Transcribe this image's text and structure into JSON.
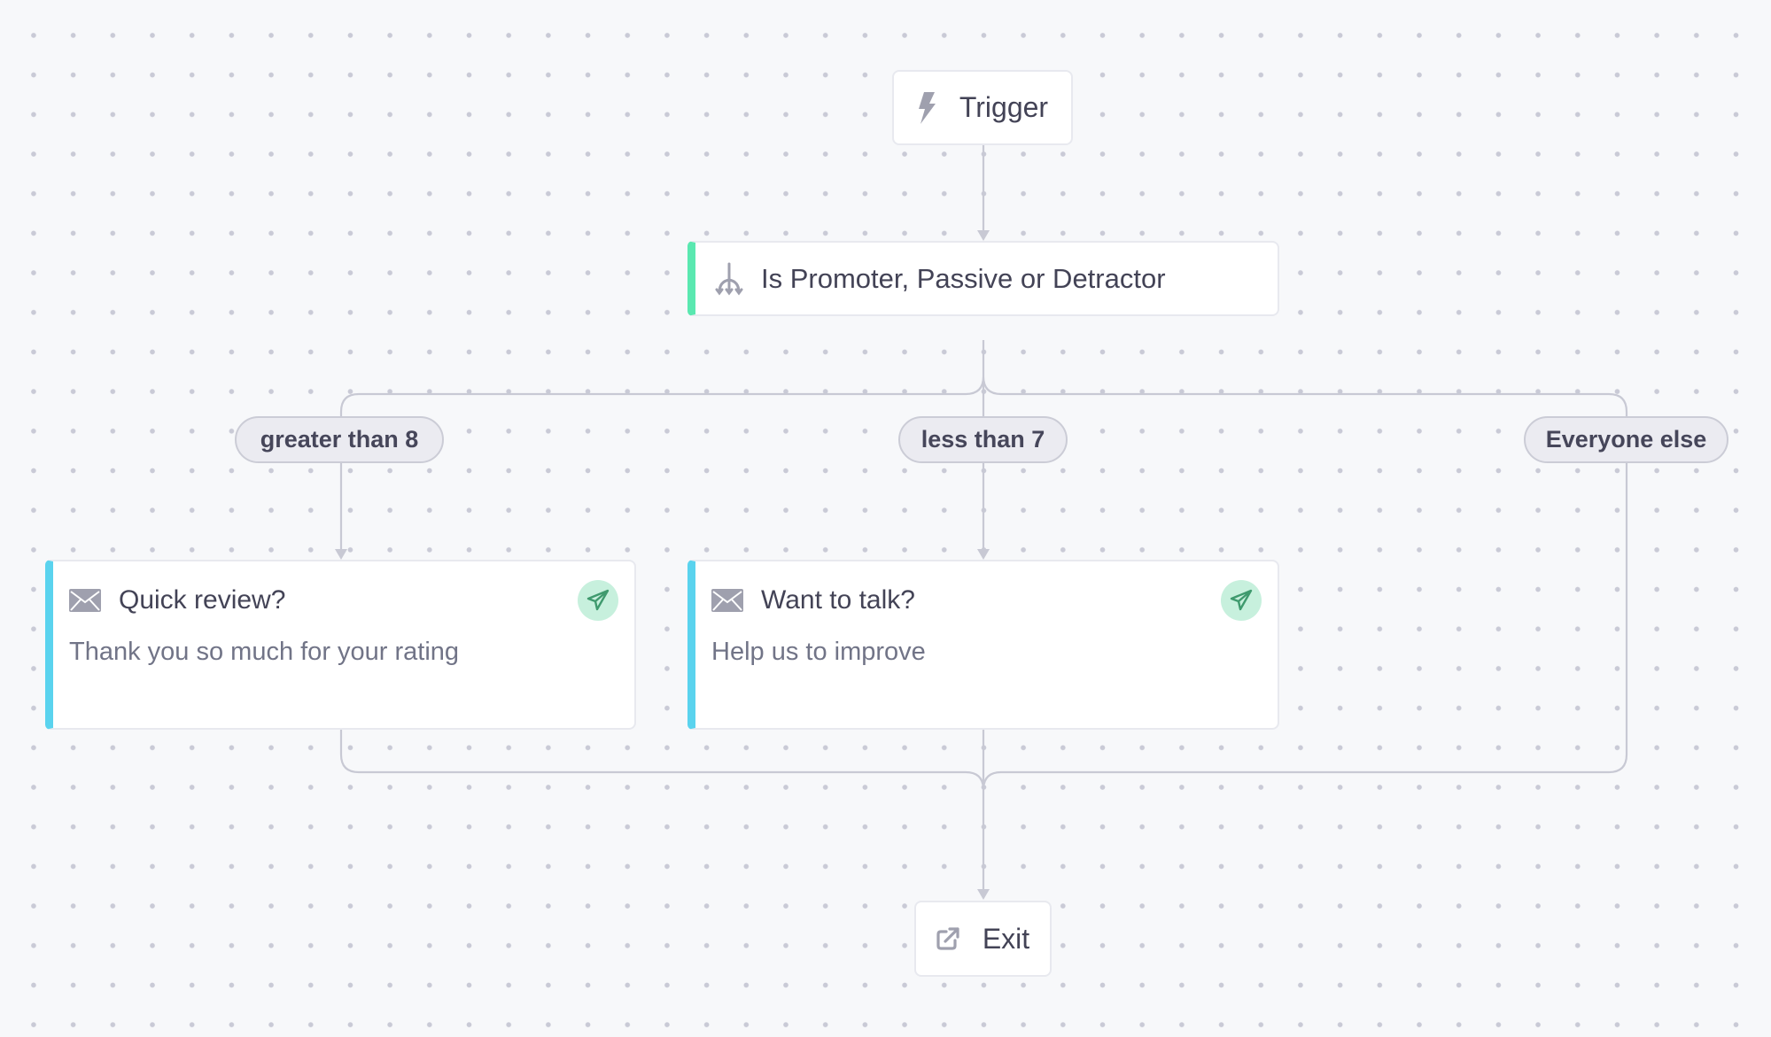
{
  "flow": {
    "trigger": {
      "label": "Trigger",
      "icon": "lightning-icon"
    },
    "branch": {
      "label": "Is Promoter, Passive or Detractor",
      "icon": "split-icon",
      "accent": "#5ae8b0"
    },
    "conditions": [
      {
        "label": "greater than 8"
      },
      {
        "label": "less than 7"
      },
      {
        "label": "Everyone else"
      }
    ],
    "messages": [
      {
        "title": "Quick review?",
        "body": "Thank you so much for your rating",
        "icon": "envelope-icon",
        "status_icon": "send-icon",
        "accent": "#5ad3ee"
      },
      {
        "title": "Want to talk?",
        "body": "Help us to improve",
        "icon": "envelope-icon",
        "status_icon": "send-icon",
        "accent": "#5ad3ee"
      }
    ],
    "exit": {
      "label": "Exit",
      "icon": "external-link-icon"
    }
  },
  "colors": {
    "background": "#f7f8fa",
    "edge": "#c8c9d4",
    "branch_accent": "#5ae8b0",
    "message_accent": "#5ad3ee",
    "send_badge": "#c7f0dd",
    "send_icon": "#3f9a6e"
  }
}
